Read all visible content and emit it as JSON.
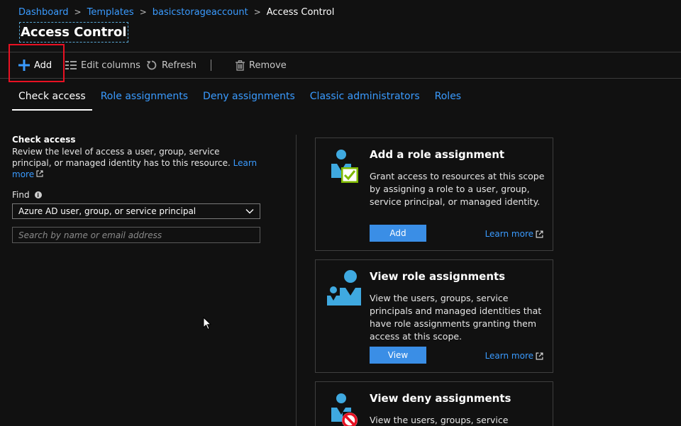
{
  "breadcrumb": {
    "items": [
      "Dashboard",
      "Templates",
      "basicstorageaccount"
    ],
    "current": "Access Control"
  },
  "page_title": "Access Control",
  "toolbar": {
    "add_label": "Add",
    "edit_columns_label": "Edit columns",
    "refresh_label": "Refresh",
    "remove_label": "Remove"
  },
  "tabs": [
    {
      "label": "Check access",
      "active": true
    },
    {
      "label": "Role assignments"
    },
    {
      "label": "Deny assignments"
    },
    {
      "label": "Classic administrators"
    },
    {
      "label": "Roles"
    }
  ],
  "check_access": {
    "heading": "Check access",
    "description": "Review the level of access a user, group, service principal, or managed identity has to this resource.",
    "learn_more": "Learn more",
    "find_label": "Find",
    "find_selected": "Azure AD user, group, or service principal",
    "search_placeholder": "Search by name or email address"
  },
  "cards": [
    {
      "title": "Add a role assignment",
      "description": "Grant access to resources at this scope by assigning a role to a user, group, service principal, or managed identity.",
      "button": "Add",
      "learn_more": "Learn more"
    },
    {
      "title": "View role assignments",
      "description": "View the users, groups, service principals and managed identities that have role assignments granting them access at this scope.",
      "button": "View",
      "learn_more": "Learn more"
    },
    {
      "title": "View deny assignments",
      "description": "View the users, groups, service principals"
    }
  ],
  "colors": {
    "background": "#111111",
    "link": "#3a9bff",
    "primary_button": "#3a8ee6",
    "highlight": "#e81123",
    "icon_blue": "#3fa9e0",
    "check_green": "#7fba00",
    "deny_red": "#e81123"
  },
  "icons": [
    "plus-icon",
    "edit-columns-icon",
    "refresh-icon",
    "trash-icon",
    "info-icon",
    "chevron-down-icon",
    "external-link-icon",
    "user-check-icon",
    "users-icon",
    "user-deny-icon",
    "mouse-cursor-icon"
  ]
}
